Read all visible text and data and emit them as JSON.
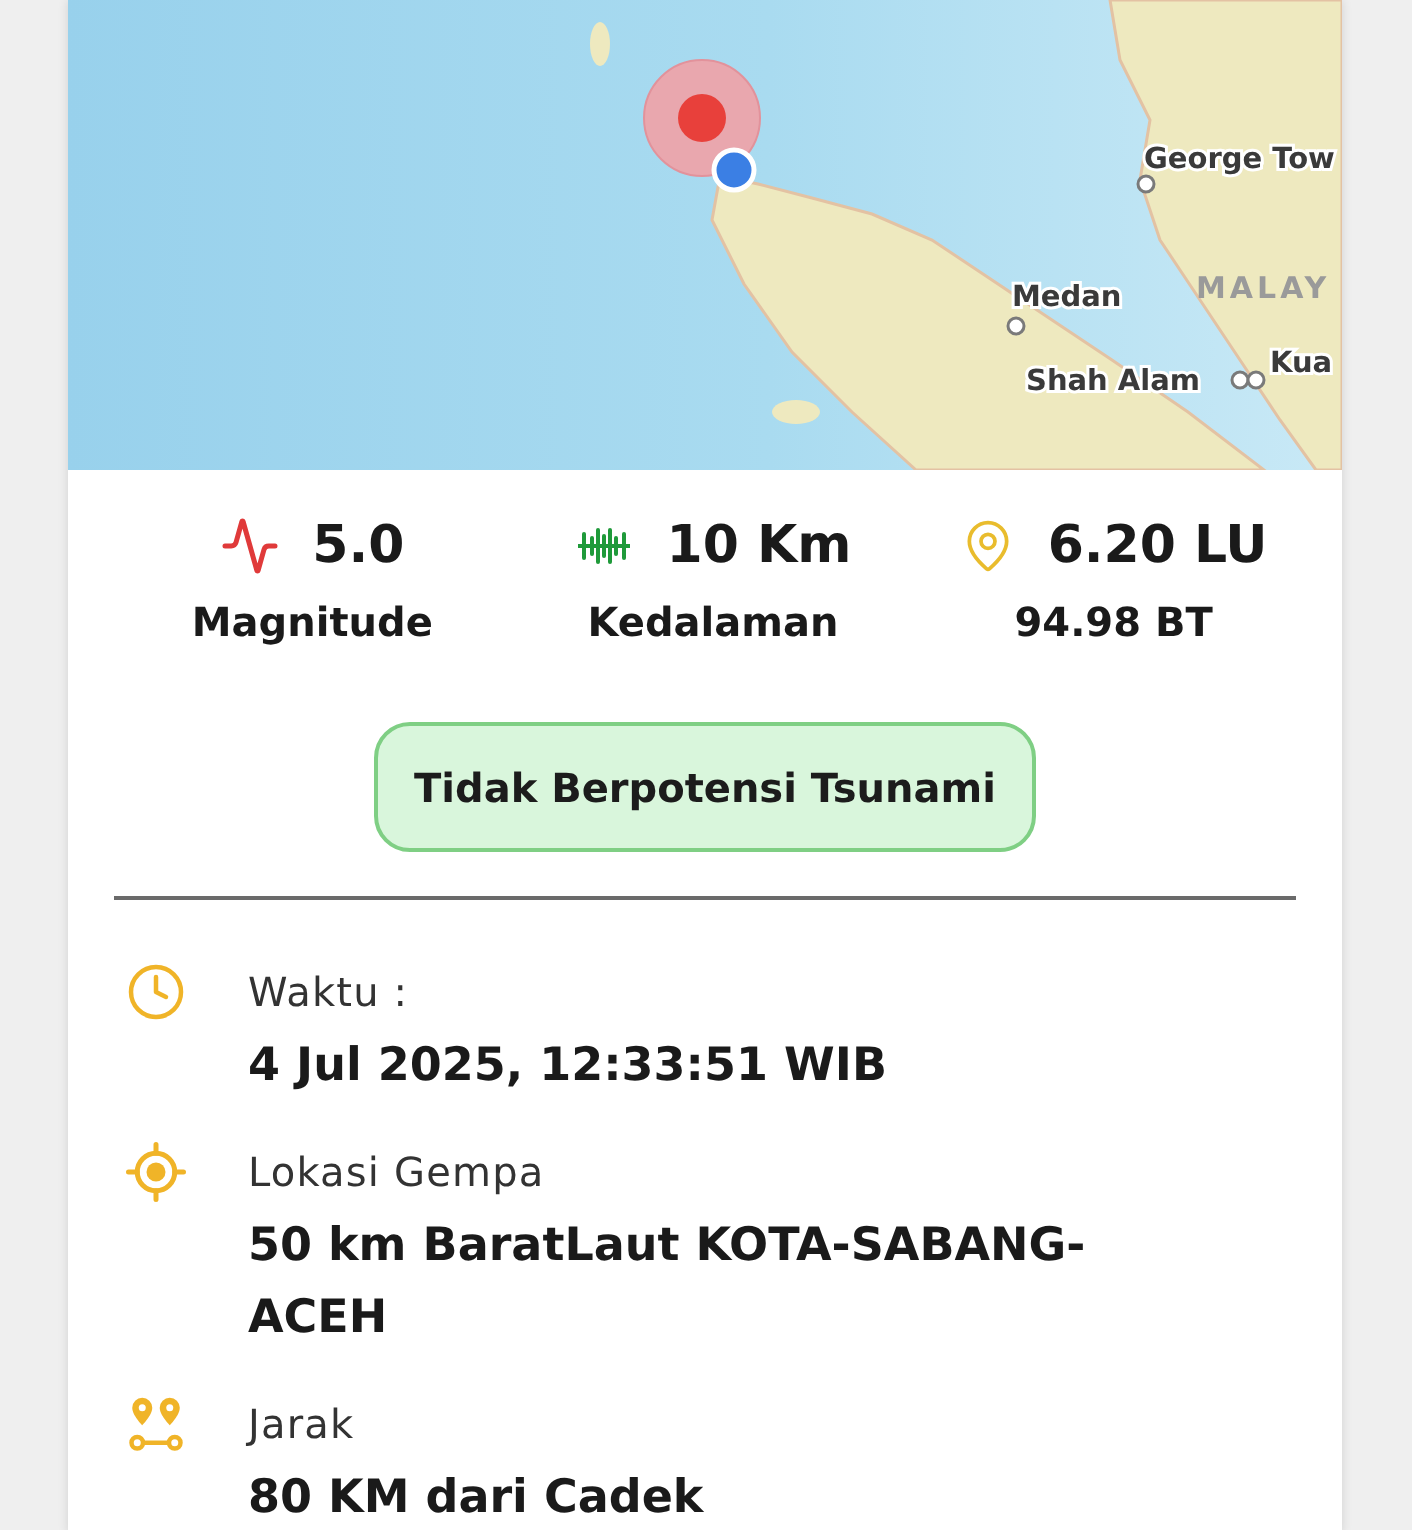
{
  "map": {
    "labels": [
      {
        "kind": "city",
        "text": "George Tow"
      },
      {
        "kind": "city",
        "text": "Medan"
      },
      {
        "kind": "country",
        "text": "MALAY"
      },
      {
        "kind": "city",
        "text": "Shah Alam"
      },
      {
        "kind": "city",
        "text": "Kua"
      }
    ]
  },
  "stats": [
    {
      "kind": "magnitude",
      "value": "5.0",
      "label": "Magnitude"
    },
    {
      "kind": "depth",
      "value": "10 Km",
      "label": "Kedalaman"
    },
    {
      "kind": "location",
      "value": "6.20 LU",
      "label": "94.98 BT"
    }
  ],
  "tsunami_status": {
    "text": "Tidak Berpotensi Tsunami",
    "warning": false
  },
  "details": [
    {
      "kind": "time",
      "label": "Waktu :",
      "value": "4 Jul 2025, 12:33:51 WIB"
    },
    {
      "kind": "location",
      "label": "Lokasi Gempa",
      "value": "50 km BaratLaut KOTA-SABANG-ACEH"
    },
    {
      "kind": "distance",
      "label": "Jarak",
      "value": "80 KM dari Cadek"
    }
  ]
}
